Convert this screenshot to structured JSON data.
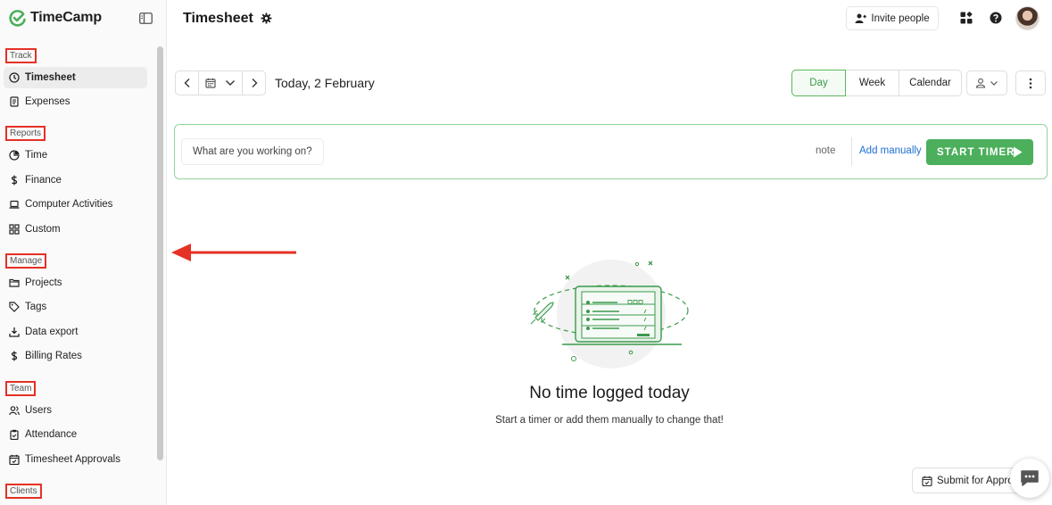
{
  "app": {
    "name": "TimeCamp"
  },
  "sidebar": {
    "sections": [
      {
        "label": "Track"
      },
      {
        "label": "Reports"
      },
      {
        "label": "Manage"
      },
      {
        "label": "Team"
      },
      {
        "label": "Clients"
      }
    ],
    "items": [
      {
        "label": "Timesheet",
        "icon": "clock-icon",
        "active": true
      },
      {
        "label": "Expenses",
        "icon": "receipt-icon"
      },
      {
        "label": "Time",
        "icon": "pie-chart-icon"
      },
      {
        "label": "Finance",
        "icon": "dollar-icon"
      },
      {
        "label": "Computer Activities",
        "icon": "laptop-icon"
      },
      {
        "label": "Custom",
        "icon": "grid-icon"
      },
      {
        "label": "Projects",
        "icon": "folder-icon"
      },
      {
        "label": "Tags",
        "icon": "tag-icon"
      },
      {
        "label": "Data export",
        "icon": "download-icon"
      },
      {
        "label": "Billing Rates",
        "icon": "dollar-icon"
      },
      {
        "label": "Users",
        "icon": "users-icon"
      },
      {
        "label": "Attendance",
        "icon": "clipboard-icon"
      },
      {
        "label": "Timesheet Approvals",
        "icon": "calendar-check-icon"
      }
    ]
  },
  "header": {
    "title": "Timesheet",
    "invite_label": "Invite people"
  },
  "date_nav": {
    "label": "Today, 2 February"
  },
  "views": {
    "day": "Day",
    "week": "Week",
    "calendar": "Calendar",
    "active": "Day"
  },
  "timer": {
    "placeholder": "What are you working on?",
    "note_label": "note",
    "add_manually_label": "Add manually",
    "start_label": "START TIMER"
  },
  "empty_state": {
    "title": "No time logged today",
    "subtitle": "Start a timer or add them manually to change that!"
  },
  "footer": {
    "submit_label": "Submit for Appro"
  },
  "colors": {
    "accent": "#4caf5c",
    "annotation": "#e53126",
    "link": "#1f6fd1"
  }
}
